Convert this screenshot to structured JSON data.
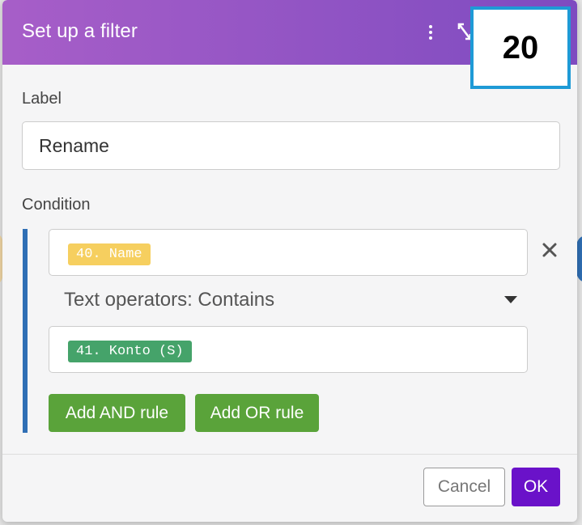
{
  "header": {
    "title": "Set up a filter",
    "menu_icon": "kebab-icon",
    "expand_icon": "expand-icon",
    "step_number": "20",
    "gradient_colors": [
      "#a75ec8",
      "#7e4bc0"
    ]
  },
  "label_field": {
    "caption": "Label",
    "value": "Rename"
  },
  "condition": {
    "caption": "Condition",
    "first_operand": {
      "token": "40. Name",
      "color": "#f6cf5f"
    },
    "operator": "Text operators: Contains",
    "second_operand": {
      "token": "41. Konto (S)",
      "color": "#45a36a"
    },
    "remove_icon": "close-icon",
    "dropdown_icon": "caret-down-icon",
    "add_and_label": "Add AND rule",
    "add_or_label": "Add OR rule",
    "rule_button_color": "#5aa33a"
  },
  "footer": {
    "cancel_label": "Cancel",
    "ok_label": "OK",
    "ok_color": "#6a12c9"
  }
}
